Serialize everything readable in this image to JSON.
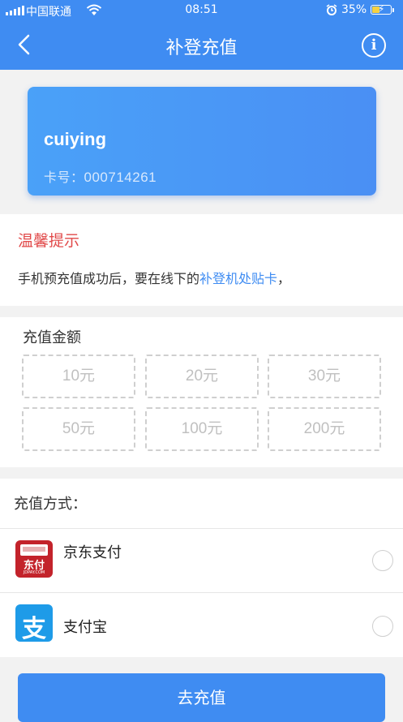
{
  "status_bar": {
    "carrier": "中国联通",
    "time": "08:51",
    "battery": "35%",
    "icons": [
      "signal-icon",
      "wifi-icon",
      "alarm-icon",
      "battery-icon"
    ]
  },
  "nav": {
    "title": "补登充值",
    "back_icon": "chevron-left-icon",
    "info_icon": "info-icon",
    "info_glyph": "i"
  },
  "card": {
    "name": "cuiying",
    "number_label": "卡号：",
    "number": "000714261"
  },
  "tip": {
    "title": "温馨提示",
    "text_before": "手机预充值成功后，要在线下的",
    "text_highlight": "补登机处贴卡",
    "text_after": "，"
  },
  "amount": {
    "title": "充值金额",
    "options": [
      "10元",
      "20元",
      "30元",
      "50元",
      "100元",
      "200元"
    ]
  },
  "payment": {
    "title": "充值方式：",
    "methods": [
      {
        "label": "京东支付",
        "icon": "jd-pay-icon",
        "icon_text": "东付",
        "icon_subtext": "JDPAY.COM"
      },
      {
        "label": "支付宝",
        "icon": "alipay-icon",
        "icon_text": "支"
      }
    ]
  },
  "submit_label": "去充值",
  "colors": {
    "primary": "#3f8cf2",
    "warning": "#e14a4a",
    "jd_red": "#c3232b",
    "alipay_blue": "#1e9be8"
  }
}
